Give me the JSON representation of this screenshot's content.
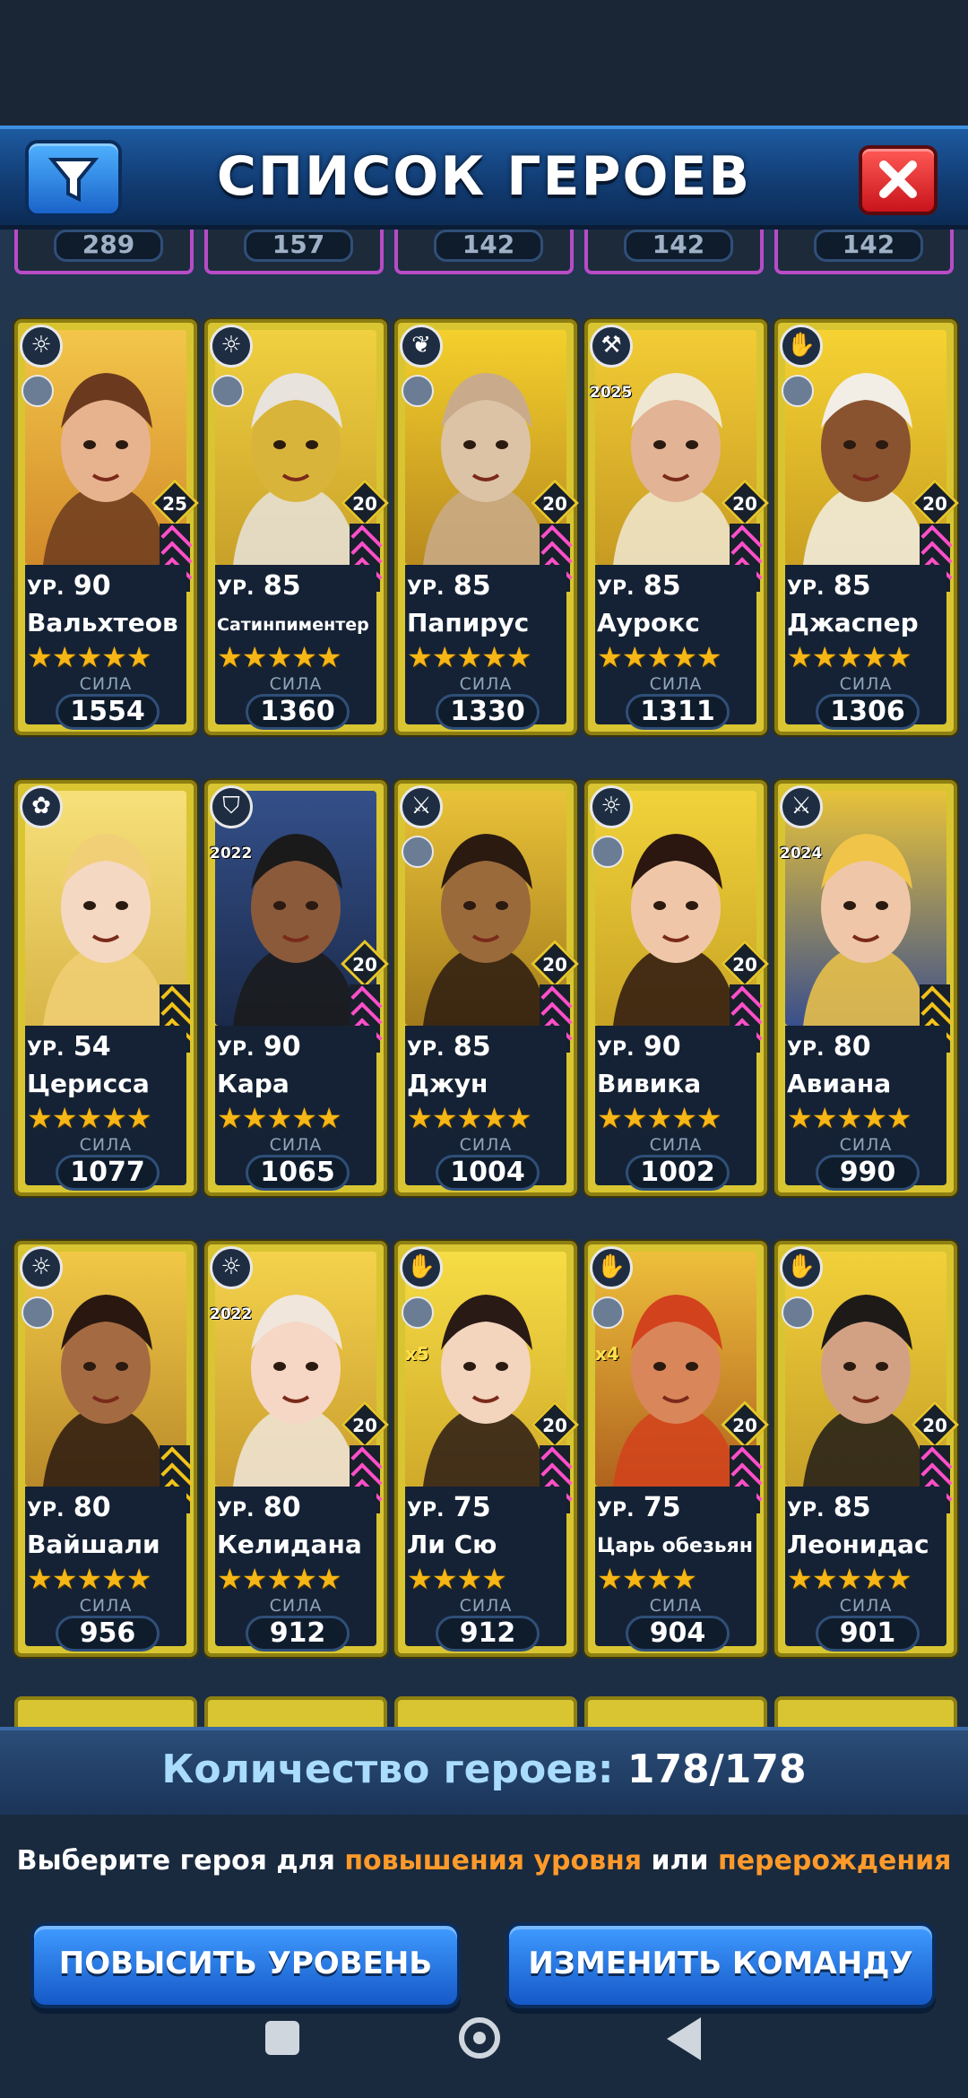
{
  "header": {
    "title": "СПИСОК ГЕРОЕВ"
  },
  "previous_row_powers": [
    "289",
    "157",
    "142",
    "142",
    "142"
  ],
  "level_prefix": "УР.",
  "power_label": "СИЛА",
  "heroes": [
    {
      "name": "Вальхтеов",
      "level": "90",
      "tier": "25",
      "stars": "★★★★★",
      "power": "1554",
      "class_icon": "sun-icon",
      "sub_icon": "helmet-icon",
      "year": "",
      "mult": "",
      "bg": [
        "#f3c64a",
        "#d28a2a"
      ],
      "skin": "#e7b38f",
      "hair": "#6b3a1e"
    },
    {
      "name": "Сатинпиментер",
      "level": "85",
      "tier": "20",
      "stars": "★★★★★",
      "power": "1360",
      "class_icon": "sun-icon",
      "sub_icon": "butterfly-icon",
      "year": "",
      "mult": "",
      "bg": [
        "#f0d040",
        "#c9a12a"
      ],
      "skin": "#d9b43a",
      "hair": "#e8e3dc"
    },
    {
      "name": "Папирус",
      "level": "85",
      "tier": "20",
      "stars": "★★★★★",
      "power": "1330",
      "class_icon": "feather-icon",
      "sub_icon": "moon-icon",
      "year": "",
      "mult": "",
      "bg": [
        "#f4d02c",
        "#b98a1e"
      ],
      "skin": "#dcc3a5",
      "hair": "#c9ab8b"
    },
    {
      "name": "Аурокс",
      "level": "85",
      "tier": "20",
      "stars": "★★★★★",
      "power": "1311",
      "class_icon": "hammer-icon",
      "sub_icon": "",
      "year": "2025",
      "mult": "",
      "bg": [
        "#f2cc35",
        "#c79b22"
      ],
      "skin": "#e2b394",
      "hair": "#f0e7d2"
    },
    {
      "name": "Джаспер",
      "level": "85",
      "tier": "20",
      "stars": "★★★★★",
      "power": "1306",
      "class_icon": "hand-icon",
      "sub_icon": "egg-icon",
      "year": "",
      "mult": "",
      "bg": [
        "#f6d233",
        "#caa021"
      ],
      "skin": "#8a5330",
      "hair": "#f2eee6"
    },
    {
      "name": "Церисса",
      "level": "54",
      "tier": "",
      "stars": "★★★★★",
      "power": "1077",
      "class_icon": "rose-icon",
      "sub_icon": "",
      "year": "",
      "mult": "",
      "bg": [
        "#f7e07a",
        "#d8b547"
      ],
      "skin": "#f4d8c2",
      "hair": "#f0cf76"
    },
    {
      "name": "Кара",
      "level": "90",
      "tier": "20",
      "stars": "★★★★★",
      "power": "1065",
      "class_icon": "shield-icon",
      "sub_icon": "",
      "year": "2022",
      "mult": "",
      "bg": [
        "#34508a",
        "#1b2a4a"
      ],
      "skin": "#8a5a3a",
      "hair": "#1a1a1a"
    },
    {
      "name": "Джун",
      "level": "85",
      "tier": "20",
      "stars": "★★★★★",
      "power": "1004",
      "class_icon": "swords-icon",
      "sub_icon": "trophy-icon",
      "year": "",
      "mult": "",
      "bg": [
        "#e9c238",
        "#a37b1c"
      ],
      "skin": "#9b6a3b",
      "hair": "#2a1a10"
    },
    {
      "name": "Вивика",
      "level": "90",
      "tier": "20",
      "stars": "★★★★★",
      "power": "1002",
      "class_icon": "sun-icon",
      "sub_icon": "trophy-icon",
      "year": "",
      "mult": "",
      "bg": [
        "#f1d23a",
        "#c8a324"
      ],
      "skin": "#efc7a8",
      "hair": "#2b1610"
    },
    {
      "name": "Авиана",
      "level": "80",
      "tier": "",
      "stars": "★★★★★",
      "power": "990",
      "class_icon": "swords-icon",
      "sub_icon": "",
      "year": "2024",
      "mult": "",
      "bg": [
        "#e8c23a",
        "#3a4f8c"
      ],
      "skin": "#efc7a8",
      "hair": "#f0c448"
    },
    {
      "name": "Вайшали",
      "level": "80",
      "tier": "",
      "stars": "★★★★★",
      "power": "956",
      "class_icon": "sun-icon",
      "sub_icon": "lamp-icon",
      "year": "",
      "mult": "",
      "bg": [
        "#f1c846",
        "#b88a2a"
      ],
      "skin": "#a46a42",
      "hair": "#2a1810"
    },
    {
      "name": "Келидана",
      "level": "80",
      "tier": "20",
      "stars": "★★★★★",
      "power": "912",
      "class_icon": "sun-icon",
      "sub_icon": "",
      "year": "2022",
      "mult": "",
      "bg": [
        "#f4d24c",
        "#c99d2e"
      ],
      "skin": "#f6d6c4",
      "hair": "#f0e6dc"
    },
    {
      "name": "Ли Сю",
      "level": "75",
      "tier": "20",
      "stars": "★★★★",
      "power": "912",
      "class_icon": "hand-icon",
      "sub_icon": "trophy-icon",
      "year": "",
      "mult": "x5",
      "bg": [
        "#f6dc45",
        "#d0aa2a"
      ],
      "skin": "#f3d4bd",
      "hair": "#2a1a16"
    },
    {
      "name": "Царь обезьян",
      "level": "75",
      "tier": "20",
      "stars": "★★★★",
      "power": "904",
      "class_icon": "hand-icon",
      "sub_icon": "trophy-icon",
      "year": "",
      "mult": "x4",
      "bg": [
        "#eebf3c",
        "#b0631e"
      ],
      "skin": "#d9865a",
      "hair": "#d2421c"
    },
    {
      "name": "Леонидас",
      "level": "85",
      "tier": "20",
      "stars": "★★★★★",
      "power": "901",
      "class_icon": "hand-icon",
      "sub_icon": "trophy-icon",
      "year": "",
      "mult": "",
      "bg": [
        "#f2d03a",
        "#c6a028"
      ],
      "skin": "#d2a184",
      "hair": "#1e1a18"
    }
  ],
  "footer": {
    "count_label": "Количество героев:",
    "count_value": "178/178",
    "hint_prefix": "Выберите героя для",
    "hint_upgrade": "повышения уровня",
    "hint_or": "или",
    "hint_rebirth": "перерождения",
    "btn_level_up": "ПОВЫСИТЬ УРОВЕНЬ",
    "btn_change_team": "ИЗМЕНИТЬ КОМАНДУ"
  },
  "colors": {
    "accent_orange": "#ff9a2a",
    "card_gold": "#d8c531",
    "rank_pink": "#ff4fc8",
    "rank_gold": "#f2c21a",
    "prev_border": "#b74cc6"
  }
}
